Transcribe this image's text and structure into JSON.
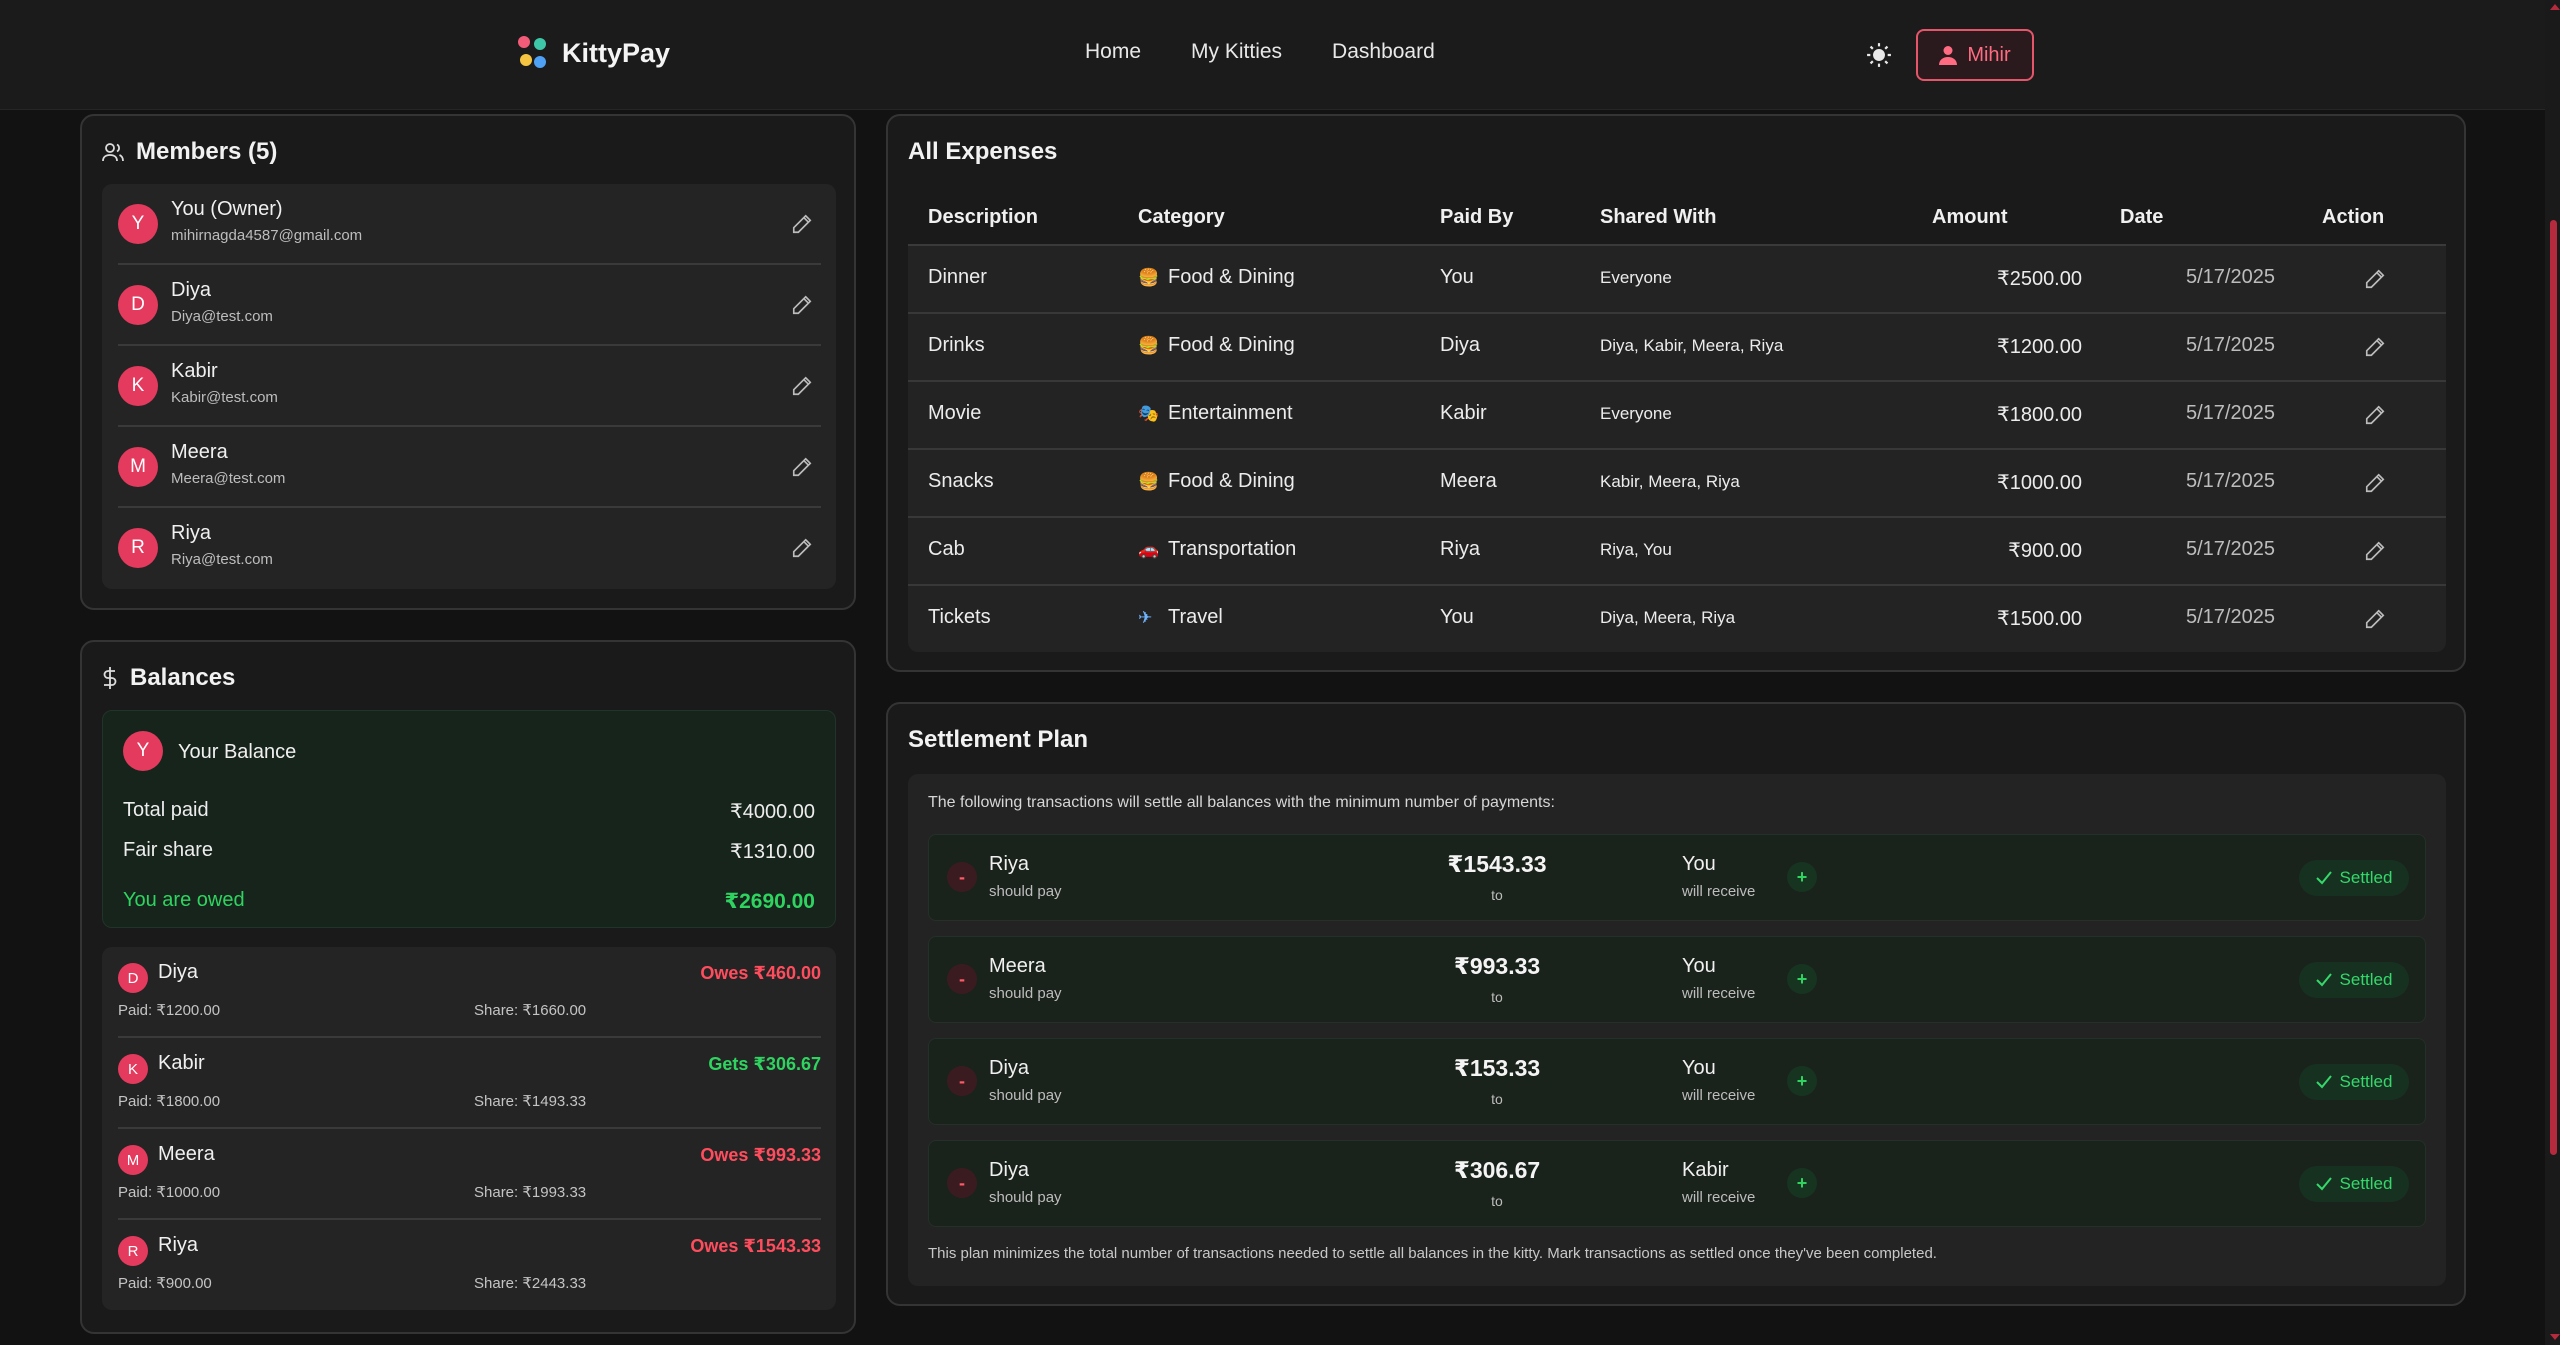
{
  "header": {
    "brand": "KittyPay",
    "nav": [
      "Home",
      "My Kitties",
      "Dashboard"
    ],
    "user": "Mihir",
    "logo_colors": [
      "#f25c78",
      "#3ec6a8",
      "#f5c542",
      "#4ea1f5"
    ]
  },
  "members": {
    "title": "Members (5)",
    "items": [
      {
        "initial": "Y",
        "name": "You (Owner)",
        "email": "mihirnagda4587@gmail.com"
      },
      {
        "initial": "D",
        "name": "Diya",
        "email": "Diya@test.com"
      },
      {
        "initial": "K",
        "name": "Kabir",
        "email": "Kabir@test.com"
      },
      {
        "initial": "M",
        "name": "Meera",
        "email": "Meera@test.com"
      },
      {
        "initial": "R",
        "name": "Riya",
        "email": "Riya@test.com"
      }
    ]
  },
  "balances": {
    "title": "Balances",
    "your": {
      "initial": "Y",
      "label": "Your Balance",
      "total_paid_label": "Total paid",
      "total_paid": "₹4000.00",
      "fair_share_label": "Fair share",
      "fair_share": "₹1310.00",
      "owed_label": "You are owed",
      "owed": "₹2690.00"
    },
    "items": [
      {
        "initial": "D",
        "name": "Diya",
        "status": "Owes ₹460.00",
        "kind": "owes",
        "paid": "Paid: ₹1200.00",
        "share": "Share: ₹1660.00"
      },
      {
        "initial": "K",
        "name": "Kabir",
        "status": "Gets ₹306.67",
        "kind": "gets",
        "paid": "Paid: ₹1800.00",
        "share": "Share: ₹1493.33"
      },
      {
        "initial": "M",
        "name": "Meera",
        "status": "Owes ₹993.33",
        "kind": "owes",
        "paid": "Paid: ₹1000.00",
        "share": "Share: ₹1993.33"
      },
      {
        "initial": "R",
        "name": "Riya",
        "status": "Owes ₹1543.33",
        "kind": "owes",
        "paid": "Paid: ₹900.00",
        "share": "Share: ₹2443.33"
      }
    ]
  },
  "expenses": {
    "title": "All Expenses",
    "columns": [
      "Description",
      "Category",
      "Paid By",
      "Shared With",
      "Amount",
      "Date",
      "Action"
    ],
    "rows": [
      {
        "desc": "Dinner",
        "cat_icon": "🍔",
        "category": "Food & Dining",
        "paid_by": "You",
        "shared": "Everyone",
        "amount": "₹2500.00",
        "date": "5/17/2025"
      },
      {
        "desc": "Drinks",
        "cat_icon": "🍔",
        "category": "Food & Dining",
        "paid_by": "Diya",
        "shared": "Diya, Kabir, Meera, Riya",
        "amount": "₹1200.00",
        "date": "5/17/2025"
      },
      {
        "desc": "Movie",
        "cat_icon": "🎭",
        "category": "Entertainment",
        "paid_by": "Kabir",
        "shared": "Everyone",
        "amount": "₹1800.00",
        "date": "5/17/2025"
      },
      {
        "desc": "Snacks",
        "cat_icon": "🍔",
        "category": "Food & Dining",
        "paid_by": "Meera",
        "shared": "Kabir, Meera, Riya",
        "amount": "₹1000.00",
        "date": "5/17/2025"
      },
      {
        "desc": "Cab",
        "cat_icon": "🚗",
        "category": "Transportation",
        "paid_by": "Riya",
        "shared": "Riya, You",
        "amount": "₹900.00",
        "date": "5/17/2025"
      },
      {
        "desc": "Tickets",
        "cat_icon": "✈",
        "category": "Travel",
        "paid_by": "You",
        "shared": "Diya, Meera, Riya",
        "amount": "₹1500.00",
        "date": "5/17/2025"
      }
    ]
  },
  "settlement": {
    "title": "Settlement Plan",
    "intro": "The following transactions will settle all balances with the minimum number of payments:",
    "should_pay": "should pay",
    "to": "to",
    "will_receive": "will receive",
    "settled_label": "Settled",
    "rows": [
      {
        "from": "Riya",
        "amount": "₹1543.33",
        "to": "You"
      },
      {
        "from": "Meera",
        "amount": "₹993.33",
        "to": "You"
      },
      {
        "from": "Diya",
        "amount": "₹153.33",
        "to": "You"
      },
      {
        "from": "Diya",
        "amount": "₹306.67",
        "to": "Kabir"
      }
    ],
    "footer": "This plan minimizes the total number of transactions needed to settle all balances in the kitty. Mark transactions as settled once they've been completed."
  },
  "colors": {
    "accent": "#e33a5e",
    "owes": "#ff4d5e",
    "gets": "#2fd460"
  }
}
